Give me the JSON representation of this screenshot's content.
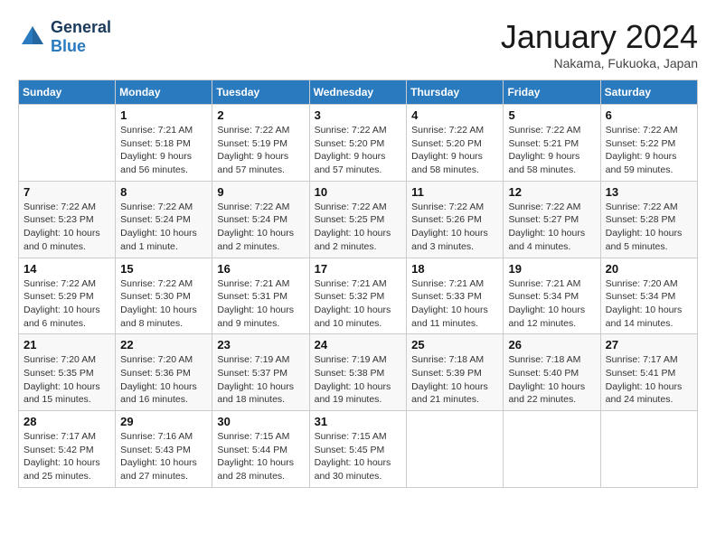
{
  "header": {
    "logo_line1": "General",
    "logo_line2": "Blue",
    "month_title": "January 2024",
    "location": "Nakama, Fukuoka, Japan"
  },
  "weekdays": [
    "Sunday",
    "Monday",
    "Tuesday",
    "Wednesday",
    "Thursday",
    "Friday",
    "Saturday"
  ],
  "rows": [
    [
      {
        "day": "",
        "sunrise": "",
        "sunset": "",
        "daylight": ""
      },
      {
        "day": "1",
        "sunrise": "Sunrise: 7:21 AM",
        "sunset": "Sunset: 5:18 PM",
        "daylight": "Daylight: 9 hours and 56 minutes."
      },
      {
        "day": "2",
        "sunrise": "Sunrise: 7:22 AM",
        "sunset": "Sunset: 5:19 PM",
        "daylight": "Daylight: 9 hours and 57 minutes."
      },
      {
        "day": "3",
        "sunrise": "Sunrise: 7:22 AM",
        "sunset": "Sunset: 5:20 PM",
        "daylight": "Daylight: 9 hours and 57 minutes."
      },
      {
        "day": "4",
        "sunrise": "Sunrise: 7:22 AM",
        "sunset": "Sunset: 5:20 PM",
        "daylight": "Daylight: 9 hours and 58 minutes."
      },
      {
        "day": "5",
        "sunrise": "Sunrise: 7:22 AM",
        "sunset": "Sunset: 5:21 PM",
        "daylight": "Daylight: 9 hours and 58 minutes."
      },
      {
        "day": "6",
        "sunrise": "Sunrise: 7:22 AM",
        "sunset": "Sunset: 5:22 PM",
        "daylight": "Daylight: 9 hours and 59 minutes."
      }
    ],
    [
      {
        "day": "7",
        "sunrise": "Sunrise: 7:22 AM",
        "sunset": "Sunset: 5:23 PM",
        "daylight": "Daylight: 10 hours and 0 minutes."
      },
      {
        "day": "8",
        "sunrise": "Sunrise: 7:22 AM",
        "sunset": "Sunset: 5:24 PM",
        "daylight": "Daylight: 10 hours and 1 minute."
      },
      {
        "day": "9",
        "sunrise": "Sunrise: 7:22 AM",
        "sunset": "Sunset: 5:24 PM",
        "daylight": "Daylight: 10 hours and 2 minutes."
      },
      {
        "day": "10",
        "sunrise": "Sunrise: 7:22 AM",
        "sunset": "Sunset: 5:25 PM",
        "daylight": "Daylight: 10 hours and 2 minutes."
      },
      {
        "day": "11",
        "sunrise": "Sunrise: 7:22 AM",
        "sunset": "Sunset: 5:26 PM",
        "daylight": "Daylight: 10 hours and 3 minutes."
      },
      {
        "day": "12",
        "sunrise": "Sunrise: 7:22 AM",
        "sunset": "Sunset: 5:27 PM",
        "daylight": "Daylight: 10 hours and 4 minutes."
      },
      {
        "day": "13",
        "sunrise": "Sunrise: 7:22 AM",
        "sunset": "Sunset: 5:28 PM",
        "daylight": "Daylight: 10 hours and 5 minutes."
      }
    ],
    [
      {
        "day": "14",
        "sunrise": "Sunrise: 7:22 AM",
        "sunset": "Sunset: 5:29 PM",
        "daylight": "Daylight: 10 hours and 6 minutes."
      },
      {
        "day": "15",
        "sunrise": "Sunrise: 7:22 AM",
        "sunset": "Sunset: 5:30 PM",
        "daylight": "Daylight: 10 hours and 8 minutes."
      },
      {
        "day": "16",
        "sunrise": "Sunrise: 7:21 AM",
        "sunset": "Sunset: 5:31 PM",
        "daylight": "Daylight: 10 hours and 9 minutes."
      },
      {
        "day": "17",
        "sunrise": "Sunrise: 7:21 AM",
        "sunset": "Sunset: 5:32 PM",
        "daylight": "Daylight: 10 hours and 10 minutes."
      },
      {
        "day": "18",
        "sunrise": "Sunrise: 7:21 AM",
        "sunset": "Sunset: 5:33 PM",
        "daylight": "Daylight: 10 hours and 11 minutes."
      },
      {
        "day": "19",
        "sunrise": "Sunrise: 7:21 AM",
        "sunset": "Sunset: 5:34 PM",
        "daylight": "Daylight: 10 hours and 12 minutes."
      },
      {
        "day": "20",
        "sunrise": "Sunrise: 7:20 AM",
        "sunset": "Sunset: 5:34 PM",
        "daylight": "Daylight: 10 hours and 14 minutes."
      }
    ],
    [
      {
        "day": "21",
        "sunrise": "Sunrise: 7:20 AM",
        "sunset": "Sunset: 5:35 PM",
        "daylight": "Daylight: 10 hours and 15 minutes."
      },
      {
        "day": "22",
        "sunrise": "Sunrise: 7:20 AM",
        "sunset": "Sunset: 5:36 PM",
        "daylight": "Daylight: 10 hours and 16 minutes."
      },
      {
        "day": "23",
        "sunrise": "Sunrise: 7:19 AM",
        "sunset": "Sunset: 5:37 PM",
        "daylight": "Daylight: 10 hours and 18 minutes."
      },
      {
        "day": "24",
        "sunrise": "Sunrise: 7:19 AM",
        "sunset": "Sunset: 5:38 PM",
        "daylight": "Daylight: 10 hours and 19 minutes."
      },
      {
        "day": "25",
        "sunrise": "Sunrise: 7:18 AM",
        "sunset": "Sunset: 5:39 PM",
        "daylight": "Daylight: 10 hours and 21 minutes."
      },
      {
        "day": "26",
        "sunrise": "Sunrise: 7:18 AM",
        "sunset": "Sunset: 5:40 PM",
        "daylight": "Daylight: 10 hours and 22 minutes."
      },
      {
        "day": "27",
        "sunrise": "Sunrise: 7:17 AM",
        "sunset": "Sunset: 5:41 PM",
        "daylight": "Daylight: 10 hours and 24 minutes."
      }
    ],
    [
      {
        "day": "28",
        "sunrise": "Sunrise: 7:17 AM",
        "sunset": "Sunset: 5:42 PM",
        "daylight": "Daylight: 10 hours and 25 minutes."
      },
      {
        "day": "29",
        "sunrise": "Sunrise: 7:16 AM",
        "sunset": "Sunset: 5:43 PM",
        "daylight": "Daylight: 10 hours and 27 minutes."
      },
      {
        "day": "30",
        "sunrise": "Sunrise: 7:15 AM",
        "sunset": "Sunset: 5:44 PM",
        "daylight": "Daylight: 10 hours and 28 minutes."
      },
      {
        "day": "31",
        "sunrise": "Sunrise: 7:15 AM",
        "sunset": "Sunset: 5:45 PM",
        "daylight": "Daylight: 10 hours and 30 minutes."
      },
      {
        "day": "",
        "sunrise": "",
        "sunset": "",
        "daylight": ""
      },
      {
        "day": "",
        "sunrise": "",
        "sunset": "",
        "daylight": ""
      },
      {
        "day": "",
        "sunrise": "",
        "sunset": "",
        "daylight": ""
      }
    ]
  ]
}
